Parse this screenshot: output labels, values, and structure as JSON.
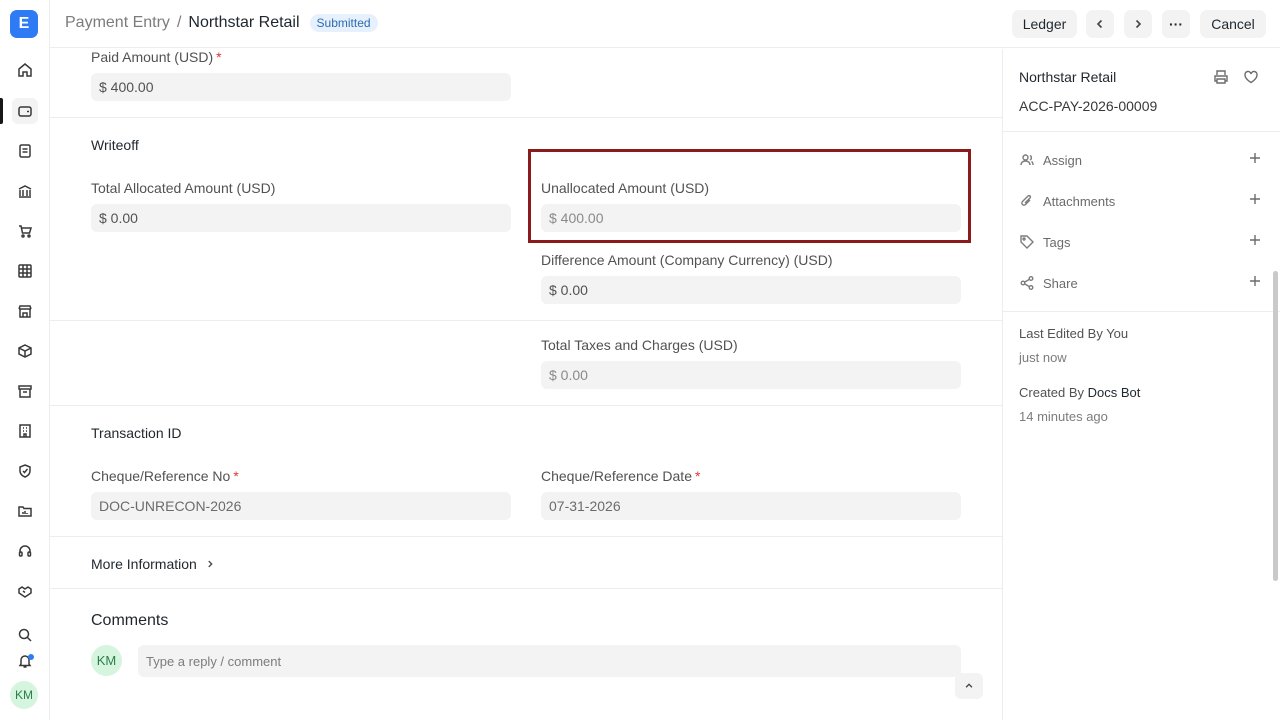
{
  "app": {
    "logo_letter": "E"
  },
  "header": {
    "breadcrumb_parent": "Payment Entry",
    "breadcrumb_sep": "/",
    "title": "Northstar Retail",
    "status_badge": "Submitted",
    "ledger_label": "Ledger",
    "more_label": "···",
    "cancel_label": "Cancel"
  },
  "form": {
    "paid_amount": {
      "label": "Paid Amount (USD)",
      "value": "$ 400.00",
      "required": "*"
    },
    "writeoff": {
      "title": "Writeoff",
      "total_allocated": {
        "label": "Total Allocated Amount (USD)",
        "value": "$ 0.00"
      },
      "unallocated": {
        "label": "Unallocated Amount (USD)",
        "value": "$ 400.00"
      },
      "difference": {
        "label": "Difference Amount (Company Currency) (USD)",
        "value": "$ 0.00"
      }
    },
    "taxes": {
      "label": "Total Taxes and Charges (USD)",
      "value": "$ 0.00"
    },
    "transaction": {
      "title": "Transaction ID",
      "ref_no": {
        "label": "Cheque/Reference No",
        "value": "DOC-UNRECON-2026",
        "required": "*"
      },
      "ref_date": {
        "label": "Cheque/Reference Date",
        "value": "07-31-2026",
        "required": "*"
      }
    },
    "more_info": "More Information"
  },
  "comments": {
    "title": "Comments",
    "avatar_initials": "KM",
    "placeholder": "Type a reply / comment"
  },
  "sidebar": {
    "title": "Northstar Retail",
    "doc_id": "ACC-PAY-2026-00009",
    "items": [
      {
        "label": "Assign",
        "icon": "user-icon"
      },
      {
        "label": "Attachments",
        "icon": "paperclip-icon"
      },
      {
        "label": "Tags",
        "icon": "tag-icon"
      },
      {
        "label": "Share",
        "icon": "share-icon"
      }
    ],
    "last_edited": "Last Edited By You",
    "last_edited_time": "just now",
    "created_by_prefix": "Created By",
    "created_by_name": "Docs Bot",
    "created_time": "14 minutes ago"
  },
  "user": {
    "initials": "KM"
  },
  "colors": {
    "accent": "#2f7bf5",
    "highlight_border": "#8b1a1a",
    "badge_bg": "#e6f1fd",
    "badge_text": "#2b6cb0"
  }
}
